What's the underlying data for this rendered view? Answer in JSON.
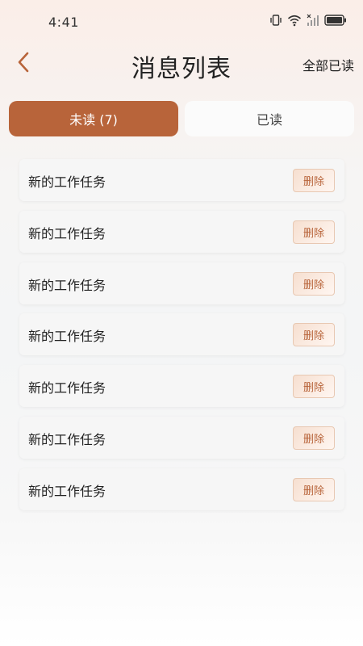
{
  "status_bar": {
    "time": "4:41"
  },
  "header": {
    "title": "消息列表",
    "mark_all_read": "全部已读"
  },
  "tabs": [
    {
      "label": "未读 (7)",
      "active": true
    },
    {
      "label": "已读",
      "active": false
    }
  ],
  "messages": [
    {
      "title": "新的工作任务",
      "delete_label": "删除"
    },
    {
      "title": "新的工作任务",
      "delete_label": "删除"
    },
    {
      "title": "新的工作任务",
      "delete_label": "删除"
    },
    {
      "title": "新的工作任务",
      "delete_label": "删除"
    },
    {
      "title": "新的工作任务",
      "delete_label": "删除"
    },
    {
      "title": "新的工作任务",
      "delete_label": "删除"
    },
    {
      "title": "新的工作任务",
      "delete_label": "删除"
    }
  ],
  "colors": {
    "accent": "#b8643a",
    "tab_inactive_bg": "#fbfbfb"
  }
}
